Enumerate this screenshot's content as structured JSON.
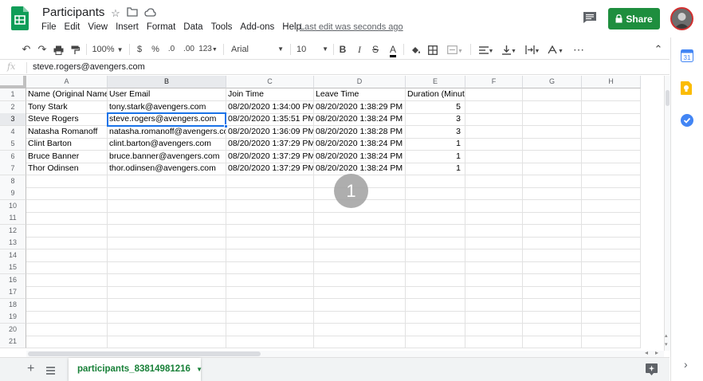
{
  "header": {
    "title": "Participants",
    "menu": [
      "File",
      "Edit",
      "View",
      "Insert",
      "Format",
      "Data",
      "Tools",
      "Add-ons",
      "Help"
    ],
    "last_edit": "Last edit was seconds ago",
    "share_label": "Share"
  },
  "toolbar": {
    "zoom": "100%",
    "currency": "$",
    "percent": "%",
    "decimal_decrease": ".0",
    "decimal_increase": ".00",
    "more_formats": "123",
    "font": "Arial",
    "font_size": "10",
    "bold": "B",
    "italic": "I",
    "strike": "S",
    "text_color": "A",
    "more": "⋯"
  },
  "formula_bar": {
    "fx": "fx",
    "value": "steve.rogers@avengers.com"
  },
  "grid": {
    "columns": [
      "A",
      "B",
      "C",
      "D",
      "E",
      "F",
      "G",
      "H"
    ],
    "row_numbers": [
      "1",
      "2",
      "3",
      "4",
      "5",
      "6",
      "7",
      "8",
      "9",
      "10",
      "11",
      "12",
      "13",
      "14",
      "15",
      "16",
      "17",
      "18",
      "19",
      "20",
      "21"
    ],
    "rows": [
      [
        "Name (Original Name)",
        "User Email",
        "Join Time",
        "Leave Time",
        "Duration (Minutes)"
      ],
      [
        "Tony Stark",
        "tony.stark@avengers.com",
        "08/20/2020 1:34:00 PM",
        "08/20/2020 1:38:29 PM",
        "5"
      ],
      [
        "Steve Rogers",
        "steve.rogers@avengers.com",
        "08/20/2020 1:35:51 PM",
        "08/20/2020 1:38:24 PM",
        "3"
      ],
      [
        "Natasha Romanoff",
        "natasha.romanoff@avengers.com",
        "08/20/2020 1:36:09 PM",
        "08/20/2020 1:38:28 PM",
        "3"
      ],
      [
        "Clint Barton",
        "clint.barton@avengers.com",
        "08/20/2020 1:37:29 PM",
        "08/20/2020 1:38:24 PM",
        "1"
      ],
      [
        "Bruce Banner",
        "bruce.banner@avengers.com",
        "08/20/2020 1:37:29 PM",
        "08/20/2020 1:38:24 PM",
        "1"
      ],
      [
        "Thor Odinsen",
        "thor.odinsen@avengers.com",
        "08/20/2020 1:37:29 PM",
        "08/20/2020 1:38:24 PM",
        "1"
      ]
    ],
    "selected_cell": "B3"
  },
  "click_marker": "1",
  "sheet_tab": {
    "label": "participants_83814981216"
  },
  "colors": {
    "accent": "#1a73e8",
    "share": "#1e8e3e",
    "sheet_tab_text": "#188038"
  }
}
